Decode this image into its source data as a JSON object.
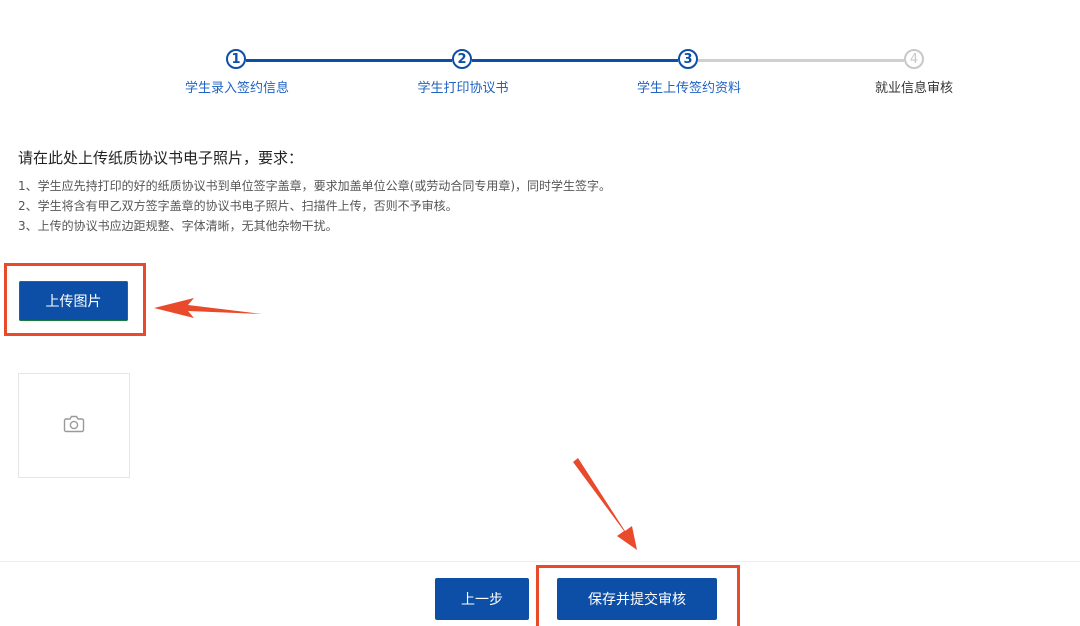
{
  "steps": [
    {
      "num": "1",
      "label": "学生录入签约信息",
      "status": "done"
    },
    {
      "num": "2",
      "label": "学生打印协议书",
      "status": "done"
    },
    {
      "num": "3",
      "label": "学生上传签约资料",
      "status": "current"
    },
    {
      "num": "4",
      "label": "就业信息审核",
      "status": "pending"
    }
  ],
  "instructions": {
    "title": "请在此处上传纸质协议书电子照片，要求：",
    "lines": [
      "1、学生应先持打印的好的纸质协议书到单位签字盖章，要求加盖单位公章(或劳动合同专用章)，同时学生签字。",
      "2、学生将含有甲乙双方签字盖章的协议书电子照片、扫描件上传，否则不予审核。",
      "3、上传的协议书应边距规整、字体清晰，无其他杂物干扰。"
    ]
  },
  "upload": {
    "button_label": "上传图片",
    "placeholder_icon": "camera-icon"
  },
  "footer": {
    "prev_label": "上一步",
    "submit_label": "保存并提交审核"
  },
  "colors": {
    "primary": "#0d4fa6",
    "step_text": "#1f62c2",
    "pending": "#c8c8c8",
    "annotation": "#e94a2b"
  }
}
